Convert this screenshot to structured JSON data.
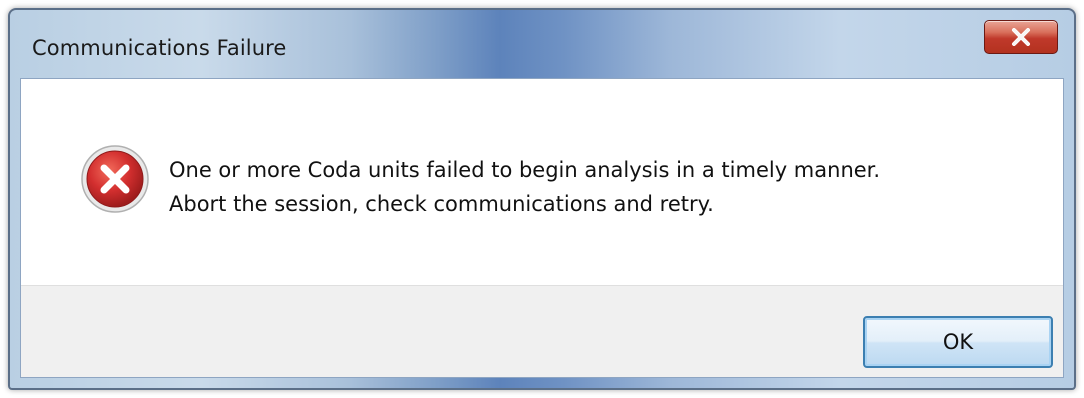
{
  "dialog": {
    "title": "Communications Failure",
    "icon": "error-icon",
    "message_lines": [
      "One or more Coda units failed to begin analysis in a timely manner.",
      "Abort the session, check communications and retry."
    ],
    "ok_label": "OK",
    "close_icon": "close-icon"
  },
  "colors": {
    "close_button": "#c0392b",
    "error_icon": "#c62828",
    "ok_border": "#3c7fb1"
  }
}
